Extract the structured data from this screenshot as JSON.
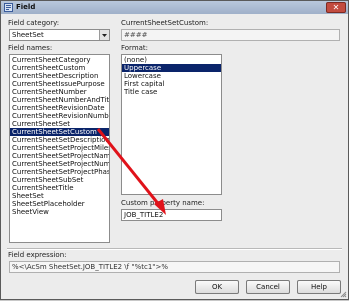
{
  "window": {
    "title": "Field",
    "close": "✕"
  },
  "left": {
    "category_label": "Field category:",
    "category_value": "SheetSet",
    "names_label": "Field names:",
    "names": [
      "CurrentSheetCategory",
      "CurrentSheetCustom",
      "CurrentSheetDescription",
      "CurrentSheetIssuePurpose",
      "CurrentSheetNumber",
      "CurrentSheetNumberAndTitle",
      "CurrentSheetRevisionDate",
      "CurrentSheetRevisionNumber",
      "CurrentSheetSet",
      "CurrentSheetSetCustom",
      "CurrentSheetSetDescription",
      "CurrentSheetSetProjectMilestone",
      "CurrentSheetSetProjectName",
      "CurrentSheetSetProjectNumber",
      "CurrentSheetSetProjectPhase",
      "CurrentSheetSubSet",
      "CurrentSheetTitle",
      "SheetSet",
      "SheetSetPlaceholder",
      "SheetView"
    ],
    "selected_index": 9
  },
  "right": {
    "custom_label": "CurrentSheetSetCustom:",
    "custom_value": "####",
    "format_label": "Format:",
    "formats": [
      "(none)",
      "Uppercase",
      "Lowercase",
      "First capital",
      "Title case"
    ],
    "selected_format": 1,
    "property_label": "Custom property name:",
    "property_value": "JOB_TITLE2"
  },
  "expression": {
    "label": "Field expression:",
    "value": "%<\\AcSm SheetSet.JOB_TITLE2 \\f \"%tc1\">%"
  },
  "buttons": {
    "ok": "OK",
    "cancel": "Cancel",
    "help": "Help"
  },
  "colors": {
    "selection": "#0a246a",
    "arrow": "#e0121a"
  }
}
